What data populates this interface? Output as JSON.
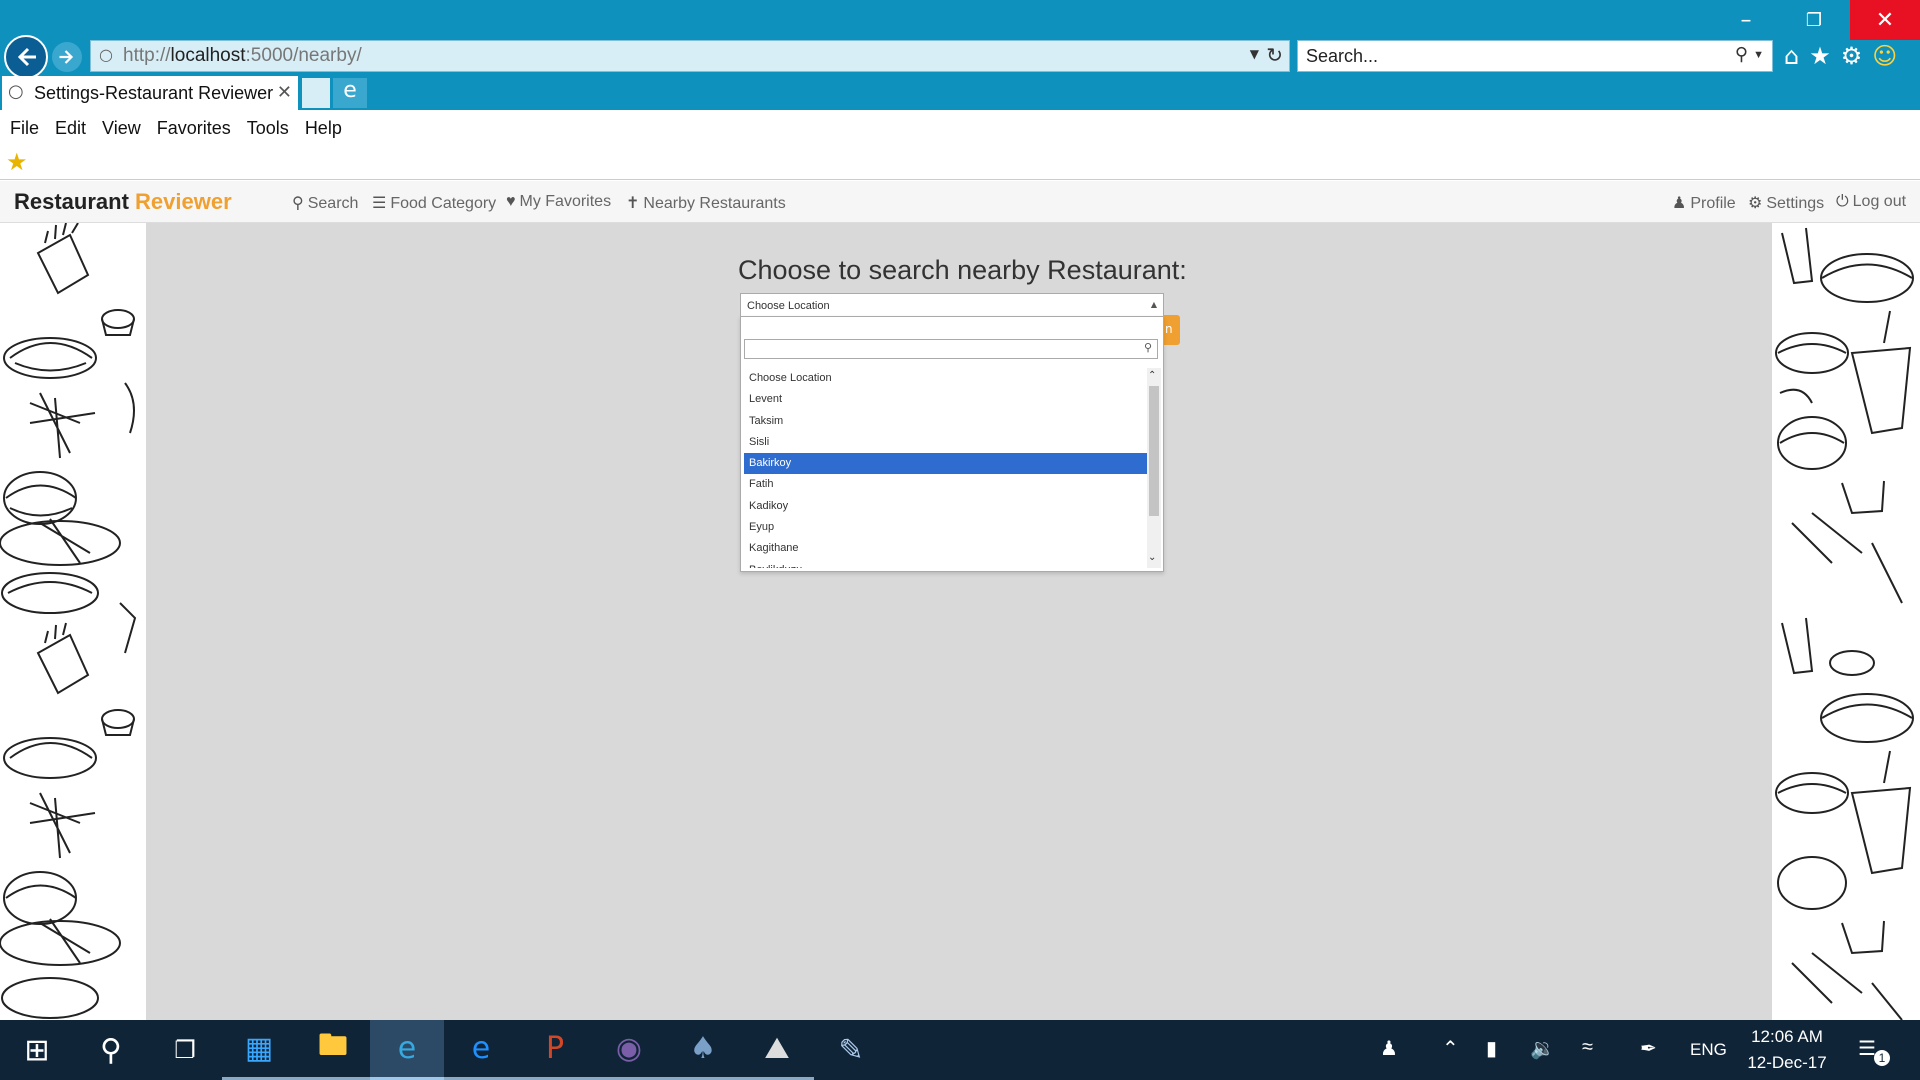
{
  "browser": {
    "url_prefix": "http://",
    "url_host": "localhost",
    "url_rest": ":5000/nearby/",
    "search_placeholder": "Search...",
    "tab_title": "Settings-Restaurant Reviewer",
    "menu": [
      "File",
      "Edit",
      "View",
      "Favorites",
      "Tools",
      "Help"
    ]
  },
  "site": {
    "brand_main": "Restaurant",
    "brand_accent": "Reviewer",
    "nav": {
      "search": "Search",
      "food_category": "Food Category",
      "my_favorites": "My Favorites",
      "nearby": "Nearby Restaurants",
      "profile": "Profile",
      "settings": "Settings",
      "logout": "Log out"
    }
  },
  "main": {
    "heading": "Choose to search nearby Restaurant:",
    "select_value": "Choose Location",
    "options": [
      "Choose Location",
      "Levent",
      "Taksim",
      "Sisli",
      "Bakirkoy",
      "Fatih",
      "Kadikoy",
      "Eyup",
      "Kagithane",
      "Beylikduzu"
    ],
    "highlighted_option": "Bakirkoy"
  },
  "taskbar": {
    "language": "ENG",
    "time": "12:06 AM",
    "date": "12-Dec-17",
    "notification_count": "1"
  },
  "colors": {
    "ie_blue": "#0f91bd",
    "accent_orange": "#f0a030",
    "highlight_blue": "#2f6cd0",
    "taskbar_bg": "#102438"
  }
}
